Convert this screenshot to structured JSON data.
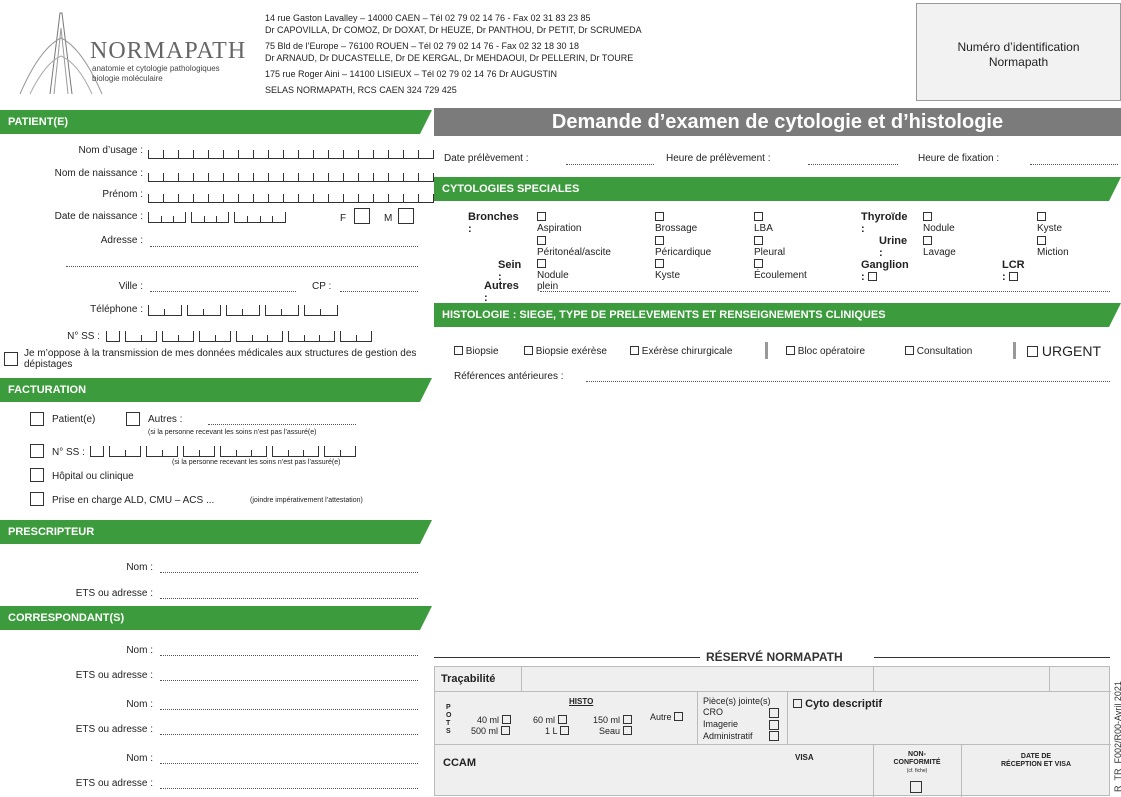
{
  "header": {
    "logo_name": "NORMAPATH",
    "logo_sub1": "anatomie et cytologie pathologiques",
    "logo_sub2": "biologie moléculaire",
    "addr": [
      "14 rue Gaston Lavalley – 14000 CAEN – Tél 02 79 02 14 76 - Fax 02 31 83 23 85",
      "Dr CAPOVILLA, Dr COMOZ, Dr DOXAT, Dr HEUZE, Dr PANTHOU, Dr PETIT, Dr SCRUMEDA",
      "75 Bld de l’Europe – 76100 ROUEN – Tél 02 79 02 14 76 - Fax 02 32 18 30 18",
      "Dr ARNAUD, Dr DUCASTELLE, Dr DE KERGAL, Dr MEHDAOUI, Dr PELLERIN, Dr TOURE",
      "175 rue Roger Aini – 14100 LISIEUX – Tél 02 79 02 14 76    Dr AUGUSTIN",
      "SELAS NORMAPATH, RCS CAEN 324 729 425"
    ],
    "id_label_1": "Numéro d’identification",
    "id_label_2": "Normapath"
  },
  "patient": {
    "title": "PATIENT(E)",
    "nom_usage": "Nom d’usage :",
    "nom_naissance": "Nom de naissance :",
    "prenom": "Prénom :",
    "date_naissance": "Date de naissance :",
    "sex_f": "F",
    "sex_m": "M",
    "adresse": "Adresse :",
    "ville": "Ville :",
    "cp": "CP :",
    "telephone": "Téléphone :",
    "nss": "N° SS :",
    "oppose": "Je m’oppose à la transmission de mes données médicales aux structures de gestion des dépistages"
  },
  "facturation": {
    "title": "FACTURATION",
    "patient": "Patient(e)",
    "autres": "Autres :",
    "autres_note": "(si la personne recevant les soins n’est pas l’assuré(e)",
    "nss": "N° SS :",
    "nss_note": "(si la personne recevant les soins n’est pas l’assuré(e)",
    "hopital": "Hôpital ou clinique",
    "ald": "Prise en charge ALD, CMU – ACS ...",
    "ald_note": "(joindre impérativement l’attestation)"
  },
  "prescripteur": {
    "title": "PRESCRIPTEUR",
    "nom": "Nom :",
    "ets": "ETS ou adresse :"
  },
  "correspondants": {
    "title": "CORRESPONDANT(S)",
    "nom": "Nom :",
    "ets": "ETS ou adresse :"
  },
  "main": {
    "title": "Demande d’examen de cytologie et d’histologie",
    "date_prel": "Date prélèvement :",
    "heure_prel": "Heure de prélèvement :",
    "heure_fix": "Heure de fixation :"
  },
  "cyto": {
    "title": "CYTOLOGIES SPECIALES",
    "bronches": "Bronches :",
    "aspiration": "Aspiration",
    "brossage": "Brossage",
    "lba": "LBA",
    "thyroide": "Thyroïde :",
    "nodule": "Nodule",
    "kyste": "Kyste",
    "peritoneal": "Péritonéal/ascite",
    "pericardique": "Péricardique",
    "pleural": "Pleural",
    "urine": "Urine :",
    "lavage": "Lavage",
    "miction": "Miction",
    "sein": "Sein :",
    "nodule_plein": "Nodule plein",
    "kyste2": "Kyste",
    "ecoulement": "Écoulement",
    "ganglion": "Ganglion :",
    "lcr": "LCR :",
    "autres": "Autres :"
  },
  "histo": {
    "title": "HISTOLOGIE : SIEGE, TYPE DE PRELEVEMENTS ET RENSEIGNEMENTS CLINIQUES",
    "biopsie": "Biopsie",
    "biopsie_ex": "Biopsie exérèse",
    "exerese": "Exérèse chirurgicale",
    "bloc": "Bloc opératoire",
    "consultation": "Consultation",
    "urgent": "URGENT",
    "refs": "Références antérieures :"
  },
  "reserve": {
    "title": "RÉSERVÉ NORMAPATH",
    "tracabilite": "Traçabilité",
    "pots": "P O T S",
    "histo": "HISTO",
    "ml40": "40 ml",
    "ml500": "500 ml",
    "ml60": "60 ml",
    "l1": "1 L",
    "ml150": "150 ml",
    "seau": "Seau",
    "autre": "Autre",
    "pieces": "Pièce(s) jointe(s)",
    "cro": "CRO",
    "imagerie": "Imagerie",
    "admin": "Administratif",
    "cyto_desc": "Cyto descriptif",
    "ccam": "CCAM",
    "visa": "VISA",
    "non_conf_1": "NON-",
    "non_conf_2": "CONFORMITÉ",
    "non_conf_note": "(cf. fiche)",
    "date_rec_1": "DATE DE",
    "date_rec_2": "RÉCEPTION ET VISA"
  },
  "side_ref": "R_TR_F002/R00-Avril 2021"
}
